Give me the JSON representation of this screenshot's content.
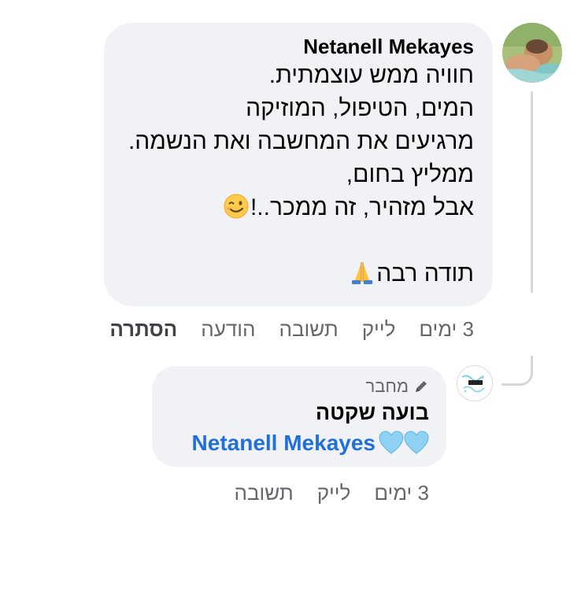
{
  "comment": {
    "author": "Netanell Mekayes",
    "lines": [
      "חוויה ממש עוצמתית.",
      "המים, הטיפול, המוזיקה",
      "מרגיעים את המחשבה ואת הנשמה.",
      "ממליץ בחום,",
      "אבל מזהיר, זה ממכר..!",
      "",
      "תודה רבה"
    ],
    "emoji_line5": "winking-face",
    "emoji_line7": "folded-hands",
    "actions": {
      "time": "3 ימים",
      "like": "לייק",
      "reply": "תשובה",
      "message": "הודעה",
      "hide": "הסתרה"
    }
  },
  "reply": {
    "badge": "מחבר",
    "author": "בועה שקטה",
    "mention": "Netanell Mekayes",
    "hearts": "two-light-blue-hearts",
    "actions": {
      "time": "3 ימים",
      "like": "לייק",
      "reply": "תשובה"
    }
  },
  "colors": {
    "bubble": "#f0f2f5",
    "secondary_text": "#65676b",
    "mention": "#216fdb",
    "heart": "#8ed1f3"
  }
}
